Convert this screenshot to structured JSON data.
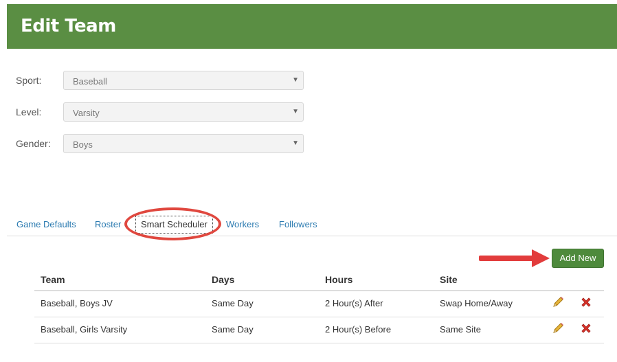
{
  "header": {
    "title": "Edit Team"
  },
  "form": {
    "sport": {
      "label": "Sport:",
      "value": "Baseball"
    },
    "level": {
      "label": "Level:",
      "value": "Varsity"
    },
    "gender": {
      "label": "Gender:",
      "value": "Boys"
    }
  },
  "tabs": [
    {
      "label": "Game Defaults"
    },
    {
      "label": "Roster"
    },
    {
      "label": "Smart Scheduler",
      "active": true
    },
    {
      "label": "Workers"
    },
    {
      "label": "Followers"
    }
  ],
  "add_button": {
    "label": "Add New"
  },
  "table": {
    "headers": [
      "Team",
      "Days",
      "Hours",
      "Site"
    ],
    "rows": [
      {
        "team": "Baseball, Boys JV",
        "days": "Same Day",
        "hours": "2 Hour(s) After",
        "site": "Swap Home/Away"
      },
      {
        "team": "Baseball, Girls Varsity",
        "days": "Same Day",
        "hours": "2 Hour(s) Before",
        "site": "Same Site"
      }
    ]
  },
  "icons": {
    "edit": "pencil-icon",
    "delete": "delete-x-icon",
    "dropdown": "caret-down-icon"
  },
  "colors": {
    "header": "#5a8e43",
    "button": "#4e8a3c",
    "link": "#2a7ab0",
    "annotation": "#e0483f"
  }
}
